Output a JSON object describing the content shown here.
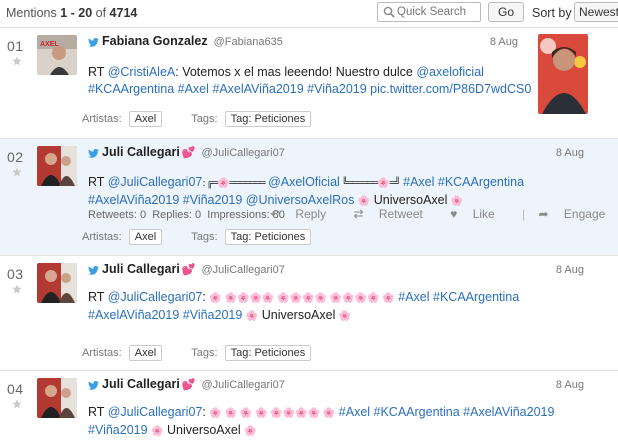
{
  "header": {
    "mentions_prefix": "Mentions ",
    "range": "1 - 20",
    "of_word": " of ",
    "total": "4714",
    "search_placeholder": "Quick Search",
    "go_label": "Go",
    "sort_label": "Sort by",
    "sort_value": "Newest"
  },
  "labels": {
    "artistas": "Artistas:",
    "tags": "Tags:"
  },
  "rows": [
    {
      "num": "01",
      "author": "Fabiana Gonzalez",
      "handle": "@Fabiana635",
      "date": "8 Aug",
      "line1_pre": "RT ",
      "line1_mention": "@CristiAleA",
      "line1_text": ": Votemos x el mas leeendo! Nuestro dulce ",
      "line1_mention2": "@axeloficial",
      "line2": "#KCAArgentina #Axel #AxelAViña2019 #Viña2019 pic.twitter.com/P86D7wdCS0",
      "artist": "Axel",
      "tag": "Tag: Peticiones"
    },
    {
      "num": "02",
      "author": "Juli Callegari",
      "handle": "@JuliCallegari07",
      "date": "8 Aug",
      "line1_pre": "RT ",
      "line1_mention": "@JuliCallegari07",
      "line1_deco1": ": ╔═",
      "line1_deco2": "═══════",
      "line1_mention2": "@AxelOficial",
      "line1_deco3": " ╚══════",
      "line1_deco4": "═╝",
      "line1_tags": "#Axel #KCAArgentina",
      "line2_tags": "#AxelAViña2019 #Viña2019 @UniversoAxelRos",
      "line2_tail": " UniversoAxel",
      "retweets_label": "Retweets: 0",
      "replies_label": "Replies: 0",
      "impressions_label": "Impressions: 80",
      "reply": "Reply",
      "retweet": "Retweet",
      "like": "Like",
      "engage": "Engage",
      "artist": "Axel",
      "tag": "Tag: Peticiones"
    },
    {
      "num": "03",
      "author": "Juli Callegari",
      "handle": "@JuliCallegari07",
      "date": "8 Aug",
      "line1_pre": "RT ",
      "line1_mention": "@JuliCallegari07",
      "line1_colon": ":",
      "line1_tags": "#Axel #KCAArgentina",
      "line2_tags": "#AxelAViña2019 #Viña2019",
      "line2_tail": " UniversoAxel",
      "artist": "Axel",
      "tag": "Tag: Peticiones"
    },
    {
      "num": "04",
      "author": "Juli Callegari",
      "handle": "@JuliCallegari07",
      "date": "8 Aug",
      "line1_pre": "RT ",
      "line1_mention": "@JuliCallegari07",
      "line1_colon": ":",
      "line1_tags": "#Axel #KCAArgentina #AxelAViña2019",
      "line2_tags": "#Viña2019",
      "line2_tail": " UniversoAxel"
    }
  ],
  "colors": {
    "link": "#2a6fbd",
    "heart": "#e3408a",
    "highlight_row": "#eef4fb"
  },
  "icons": [
    "search-icon",
    "twitter-bird-icon",
    "star-icon",
    "heart-icon",
    "reply-icon",
    "retweet-icon",
    "like-icon",
    "engage-icon"
  ]
}
